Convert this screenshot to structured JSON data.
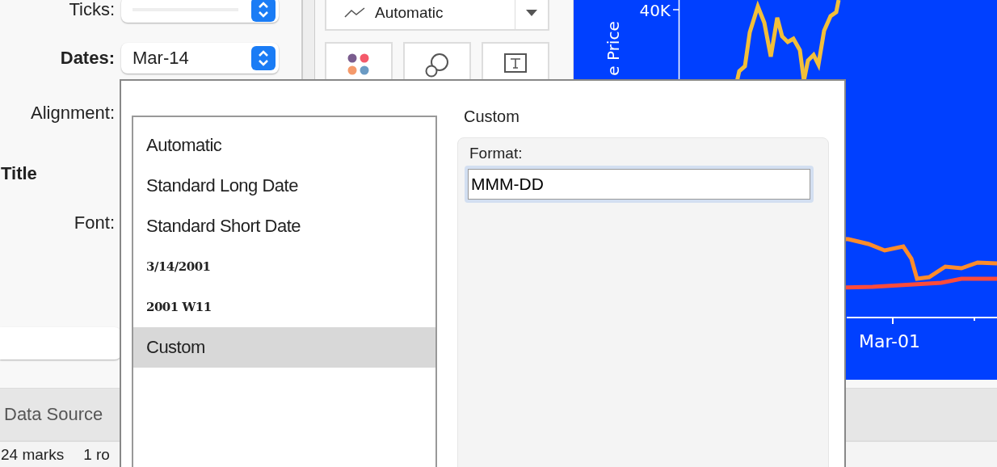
{
  "format_panel": {
    "ticks": {
      "label": "Ticks:"
    },
    "dates": {
      "label": "Dates:",
      "value": "Mar-14"
    },
    "alignment_label": "Alignment:",
    "title_heading": "Title",
    "font_label": "Font:"
  },
  "marks_card": {
    "mark_type": "Automatic",
    "buttons": [
      {
        "kind": "color"
      },
      {
        "kind": "size"
      },
      {
        "kind": "label"
      }
    ]
  },
  "chart": {
    "y_tick": "40K",
    "y_label": "e Price",
    "x_tick": "Mar-01"
  },
  "bottom_tabs": [
    {
      "label": "Data Source"
    }
  ],
  "status_bar": [
    "24 marks",
    "1 ro"
  ],
  "date_format_dialog": {
    "formats": [
      {
        "label": "Automatic",
        "kind": "name",
        "selected": false
      },
      {
        "label": "Standard Long Date",
        "kind": "name",
        "selected": false
      },
      {
        "label": "Standard Short Date",
        "kind": "name",
        "selected": false
      },
      {
        "label": "3/14/2001",
        "kind": "sample",
        "selected": false
      },
      {
        "label": "2001 W11",
        "kind": "sample",
        "selected": false
      },
      {
        "label": "Custom",
        "kind": "name",
        "selected": true
      }
    ],
    "detail_title": "Custom",
    "format_label": "Format:",
    "format_value": "MMM-DD"
  }
}
